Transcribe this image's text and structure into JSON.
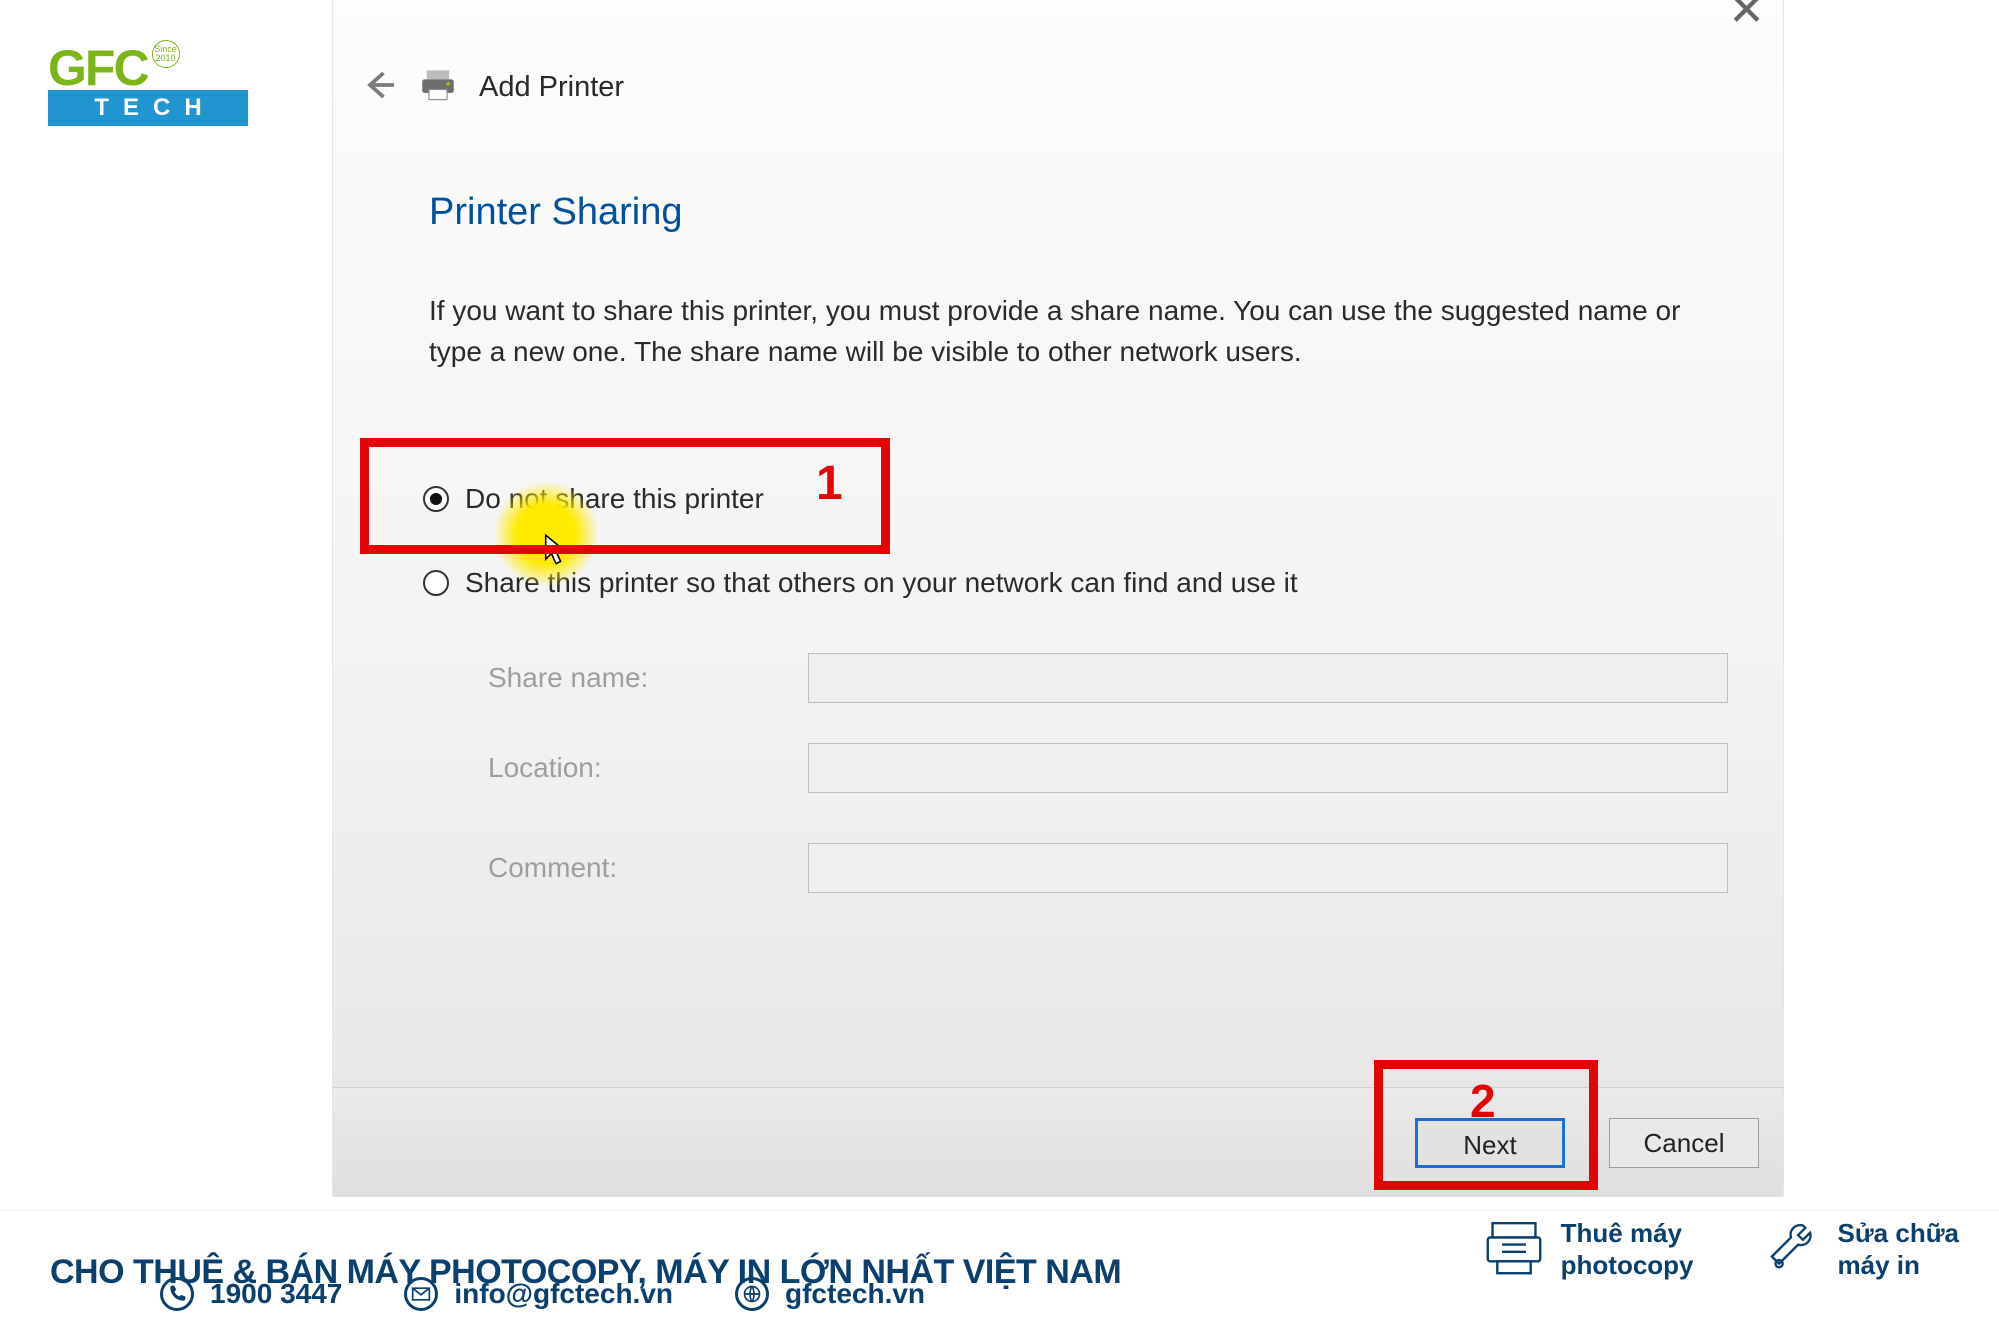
{
  "logo": {
    "company": "GFC",
    "tagline": "Since 2010",
    "sub": "TECH"
  },
  "dialog": {
    "title": "Add Printer",
    "section": "Printer Sharing",
    "explain": "If you want to share this printer, you must provide a share name. You can use the suggested name or type a new one. The share name will be visible to other network users.",
    "radio_noshare": "Do not share this printer",
    "radio_share": "Share this printer so that others on your network can find and use it",
    "share_name_label": "Share name:",
    "location_label": "Location:",
    "comment_label": "Comment:",
    "share_name_value": "",
    "location_value": "",
    "comment_value": "",
    "btn_next": "Next",
    "btn_cancel": "Cancel"
  },
  "annotations": {
    "mark1": "1",
    "mark2": "2"
  },
  "footer": {
    "slogan": "CHO THUÊ & BÁN MÁY PHOTOCOPY, MÁY IN LỚN NHẤT VIỆT NAM",
    "phone": "1900 3447",
    "email": "info@gfctech.vn",
    "web": "gfctech.vn",
    "svc1_line1": "Thuê máy",
    "svc1_line2": "photocopy",
    "svc2_line1": "Sửa chữa",
    "svc2_line2": "máy in"
  }
}
